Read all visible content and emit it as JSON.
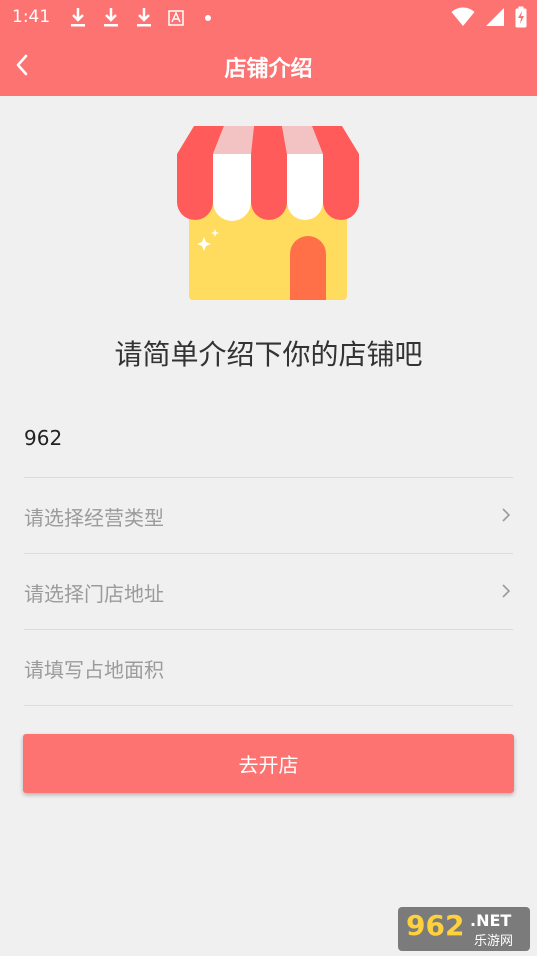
{
  "status_bar": {
    "time": "1:41",
    "icons": [
      "download-icon",
      "download-icon",
      "download-icon",
      "text-icon",
      "dot-icon",
      "wifi-icon",
      "signal-icon",
      "battery-charging-icon"
    ]
  },
  "app_bar": {
    "title": "店铺介绍",
    "back_icon": "chevron-left-icon"
  },
  "illustration": {
    "name": "shop-icon"
  },
  "headline": "请简单介绍下你的店铺吧",
  "form": {
    "store_name": {
      "value": "962"
    },
    "business_type": {
      "placeholder": "请选择经营类型"
    },
    "store_address": {
      "placeholder": "请选择门店地址"
    },
    "area": {
      "placeholder": "请填写占地面积"
    }
  },
  "submit": {
    "label": "去开店"
  },
  "watermark": {
    "num": "962",
    "net": ".NET",
    "site": "乐游网"
  },
  "colors": {
    "primary": "#fd7372",
    "background": "#f0f0f0"
  }
}
